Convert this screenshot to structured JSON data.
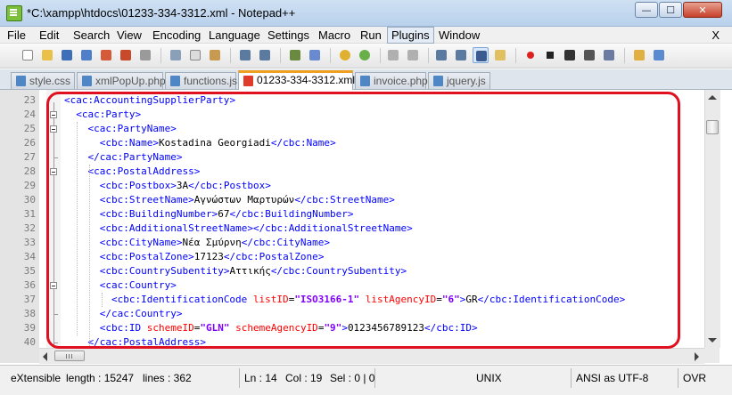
{
  "window": {
    "title": "*C:\\xampp\\htdocs\\01233-334-3312.xml - Notepad++",
    "min_glyph": "—",
    "max_glyph": "☐",
    "close_glyph": "✕"
  },
  "menu": {
    "items": [
      "File",
      "Edit",
      "Search",
      "View",
      "Encoding",
      "Language",
      "Settings",
      "Macro",
      "Run",
      "Plugins",
      "Window"
    ],
    "close": "X"
  },
  "toolbar": {
    "buttons": [
      "new-file",
      "open-file",
      "save",
      "save-all",
      "close",
      "close-all",
      "print",
      "cut",
      "copy",
      "paste",
      "undo",
      "redo",
      "find",
      "replace",
      "zoom-in",
      "zoom-out",
      "sync-vertical",
      "sync-horizontal",
      "word-wrap",
      "show-all-chars",
      "indent-guide",
      "user-defined",
      "record-macro",
      "stop-record",
      "play-macro",
      "play-multiple",
      "save-macro",
      "folder",
      "spell-check"
    ],
    "colors": {
      "accent": "#f0a020",
      "icon_blue": "#4f86c6",
      "icon_red": "#e03a2a"
    }
  },
  "tabs": [
    {
      "label": "style.css",
      "active": false
    },
    {
      "label": "xmlPopUp.php",
      "active": false
    },
    {
      "label": "functions.js",
      "active": false
    },
    {
      "label": "01233-334-3312.xml",
      "active": true
    },
    {
      "label": "invoice.php",
      "active": false
    },
    {
      "label": "jquery.js",
      "active": false
    }
  ],
  "lines": [
    {
      "n": "23",
      "text": "<cac:AccountingSupplierParty>"
    },
    {
      "n": "24",
      "text": "  <cac:Party>"
    },
    {
      "n": "25",
      "text": "    <cac:PartyName>"
    },
    {
      "n": "26",
      "text": "      <cbc:Name>Kostadina Georgiadi</cbc:Name>"
    },
    {
      "n": "27",
      "text": "    </cac:PartyName>"
    },
    {
      "n": "28",
      "text": "    <cac:PostalAddress>"
    },
    {
      "n": "29",
      "text": "      <cbc:Postbox>3A</cbc:Postbox>"
    },
    {
      "n": "30",
      "text": "      <cbc:StreetName>Αγνώστων Μαρτυρών</cbc:StreetName>"
    },
    {
      "n": "31",
      "text": "      <cbc:BuildingNumber>67</cbc:BuildingNumber>"
    },
    {
      "n": "32",
      "text": "      <cbc:AdditionalStreetName></cbc:AdditionalStreetName>"
    },
    {
      "n": "33",
      "text": "      <cbc:CityName>Νέα Σμύρνη</cbc:CityName>"
    },
    {
      "n": "34",
      "text": "      <cbc:PostalZone>17123</cbc:PostalZone>"
    },
    {
      "n": "35",
      "text": "      <cbc:CountrySubentity>Αττικής</cbc:CountrySubentity>"
    },
    {
      "n": "36",
      "text": "      <cac:Country>"
    },
    {
      "n": "37",
      "text": "        <cbc:IdentificationCode listID=\"ISO3166-1\" listAgencyID=\"6\">GR</cbc:IdentificationCode>"
    },
    {
      "n": "38",
      "text": "      </cac:Country>"
    },
    {
      "n": "39",
      "text": "      <cbc:ID schemeID=\"GLN\" schemeAgencyID=\"9\">0123456789123</cbc:ID>"
    },
    {
      "n": "40",
      "text": "    </cac:PostalAddress>"
    }
  ],
  "status": {
    "type": "eXtensible",
    "length": "length : 15247",
    "lines": "lines : 362",
    "ln": "Ln : 14",
    "col": "Col : 19",
    "sel": "Sel : 0 | 0",
    "eol": "UNIX",
    "encoding": "ANSI as UTF-8",
    "mode": "OVR"
  }
}
